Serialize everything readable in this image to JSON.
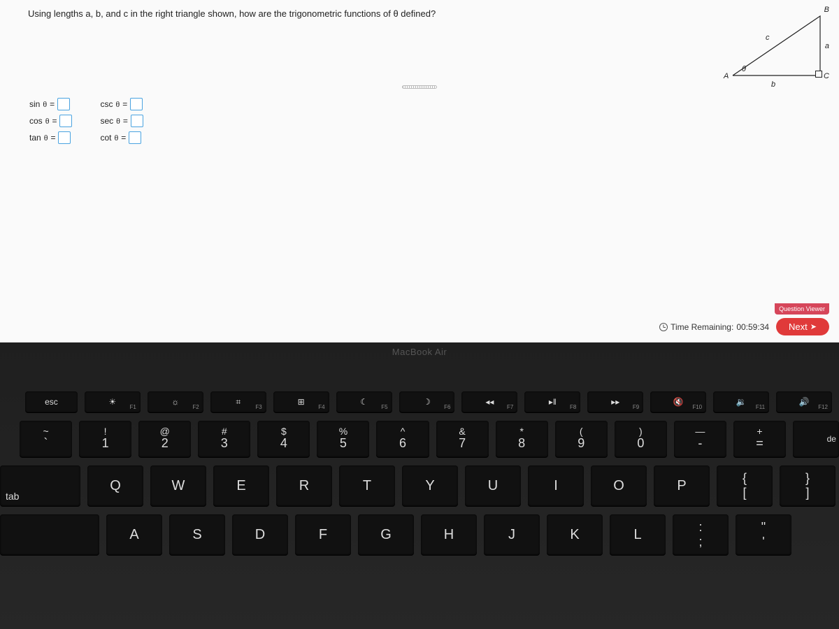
{
  "question": "Using lengths a, b, and c in the right triangle shown, how are the trigonometric functions of θ defined?",
  "triangle": {
    "A": "A",
    "B": "B",
    "C": "C",
    "a": "a",
    "b": "b",
    "c": "c",
    "theta": "θ"
  },
  "answers": {
    "col1": [
      {
        "fn": "sin",
        "var": "θ",
        "eq": "="
      },
      {
        "fn": "cos",
        "var": "θ",
        "eq": "="
      },
      {
        "fn": "tan",
        "var": "θ",
        "eq": "="
      }
    ],
    "col2": [
      {
        "fn": "csc",
        "var": "θ",
        "eq": "="
      },
      {
        "fn": "sec",
        "var": "θ",
        "eq": "="
      },
      {
        "fn": "cot",
        "var": "θ",
        "eq": "="
      }
    ]
  },
  "footer": {
    "qv": "Question Viewer",
    "time_label": "Time Remaining:",
    "time_value": "00:59:34",
    "next": "Next"
  },
  "laptop": {
    "brand": "MacBook Air",
    "fn": [
      {
        "sym": "esc",
        "f": ""
      },
      {
        "sym": "☀",
        "f": "F1"
      },
      {
        "sym": "☼",
        "f": "F2"
      },
      {
        "sym": "⌗",
        "f": "F3"
      },
      {
        "sym": "⊞",
        "f": "F4"
      },
      {
        "sym": "☾",
        "f": "F5"
      },
      {
        "sym": "☽",
        "f": "F6"
      },
      {
        "sym": "◂◂",
        "f": "F7"
      },
      {
        "sym": "▸‖",
        "f": "F8"
      },
      {
        "sym": "▸▸",
        "f": "F9"
      },
      {
        "sym": "🔇",
        "f": "F10"
      },
      {
        "sym": "🔉",
        "f": "F11"
      },
      {
        "sym": "🔊",
        "f": "F12"
      }
    ],
    "num": [
      {
        "up": "~",
        "dn": "`"
      },
      {
        "up": "!",
        "dn": "1"
      },
      {
        "up": "@",
        "dn": "2"
      },
      {
        "up": "#",
        "dn": "3"
      },
      {
        "up": "$",
        "dn": "4"
      },
      {
        "up": "%",
        "dn": "5"
      },
      {
        "up": "^",
        "dn": "6"
      },
      {
        "up": "&",
        "dn": "7"
      },
      {
        "up": "*",
        "dn": "8"
      },
      {
        "up": "(",
        "dn": "9"
      },
      {
        "up": ")",
        "dn": "0"
      },
      {
        "up": "—",
        "dn": "-"
      },
      {
        "up": "+",
        "dn": "="
      }
    ],
    "del": "de",
    "tab": "tab",
    "qrow": [
      "Q",
      "W",
      "E",
      "R",
      "T",
      "Y",
      "U",
      "I",
      "O",
      "P"
    ],
    "brackets": [
      {
        "up": "{",
        "dn": "["
      },
      {
        "up": "}",
        "dn": "]"
      }
    ],
    "arow": [
      "A",
      "S",
      "D",
      "F",
      "G",
      "H",
      "J",
      "K",
      "L"
    ],
    "colon": {
      "up": ":",
      "dn": ";"
    },
    "quote": {
      "up": "\"",
      "dn": "'"
    }
  }
}
